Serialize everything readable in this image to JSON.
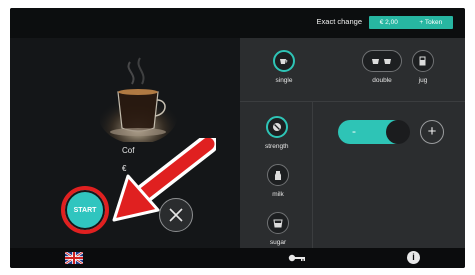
{
  "topbar": {
    "exact_change": "Exact change",
    "price": "€ 2,00",
    "token": "+ Token"
  },
  "product": {
    "name": "Cof",
    "price": "€"
  },
  "buttons": {
    "start": "START"
  },
  "options": {
    "single": "single",
    "double": "double",
    "jug": "jug",
    "strength": "strength",
    "milk": "milk",
    "sugar": "sugar"
  },
  "toggle": {
    "minus": "-",
    "plus": "+"
  },
  "icons": {
    "language": "uk-flag-icon",
    "service": "key-icon",
    "info": "info-icon"
  },
  "colors": {
    "accent": "#2ec4b6",
    "highlight": "#e02020"
  }
}
